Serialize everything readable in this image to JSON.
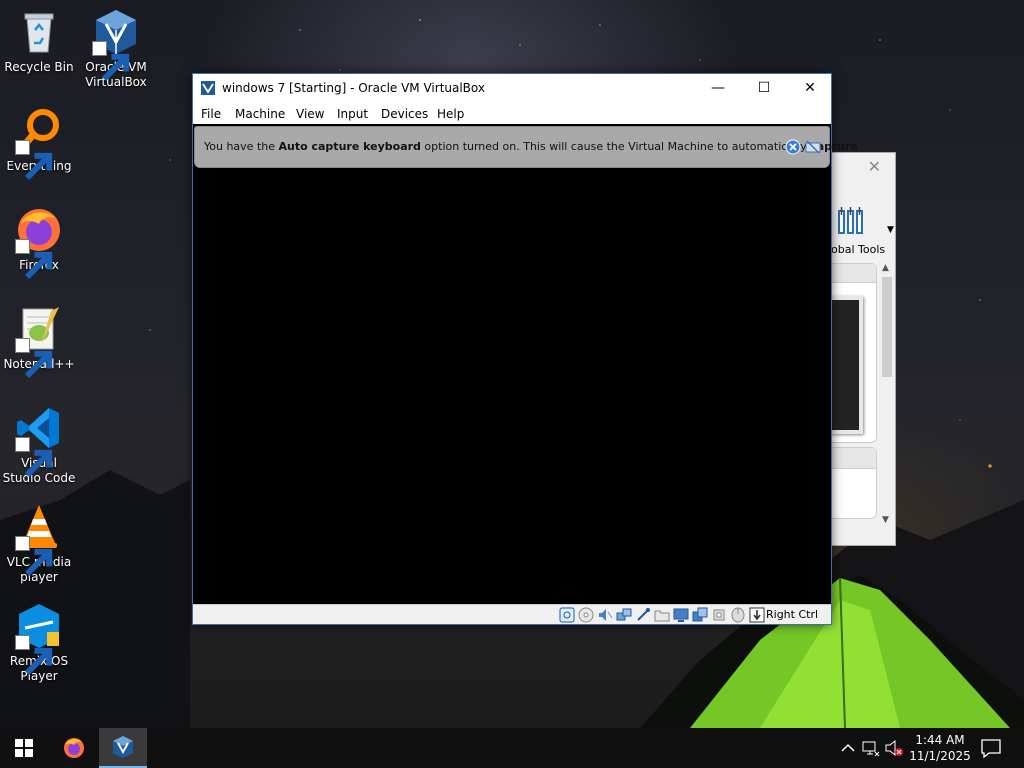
{
  "desktop": {
    "icons": [
      {
        "label": "Recycle Bin",
        "icon": "recycle-bin-icon"
      },
      {
        "label": "Oracle VM VirtualBox",
        "icon": "virtualbox-icon"
      },
      {
        "label": "Everything",
        "icon": "everything-search-icon"
      },
      {
        "label": "Firefox",
        "icon": "firefox-icon"
      },
      {
        "label": "Notepad++",
        "icon": "notepad-plus-plus-icon"
      },
      {
        "label": "Visual Studio Code",
        "icon": "vscode-icon"
      },
      {
        "label": "VLC media player",
        "icon": "vlc-icon"
      },
      {
        "label": "Remix OS Player",
        "icon": "remix-os-icon"
      }
    ]
  },
  "vm_window": {
    "title": "windows 7 [Starting] - Oracle VM VirtualBox",
    "menu": [
      "File",
      "Machine",
      "View",
      "Input",
      "Devices",
      "Help"
    ],
    "notice": {
      "prefix": "You have the ",
      "bold1": "Auto capture keyboard",
      "middle": " option turned on. This will cause the Virtual Machine to automatically ",
      "bold2": "capture"
    },
    "host_key": "Right Ctrl"
  },
  "manager_window": {
    "tools_label": "obal Tools"
  },
  "taskbar": {
    "time": "1:44 AM",
    "date": "11/1/2025"
  },
  "colors": {
    "accent": "#76b9ed",
    "vbox_blue": "#1e5a9c",
    "tent_green": "#7fdc2a"
  }
}
